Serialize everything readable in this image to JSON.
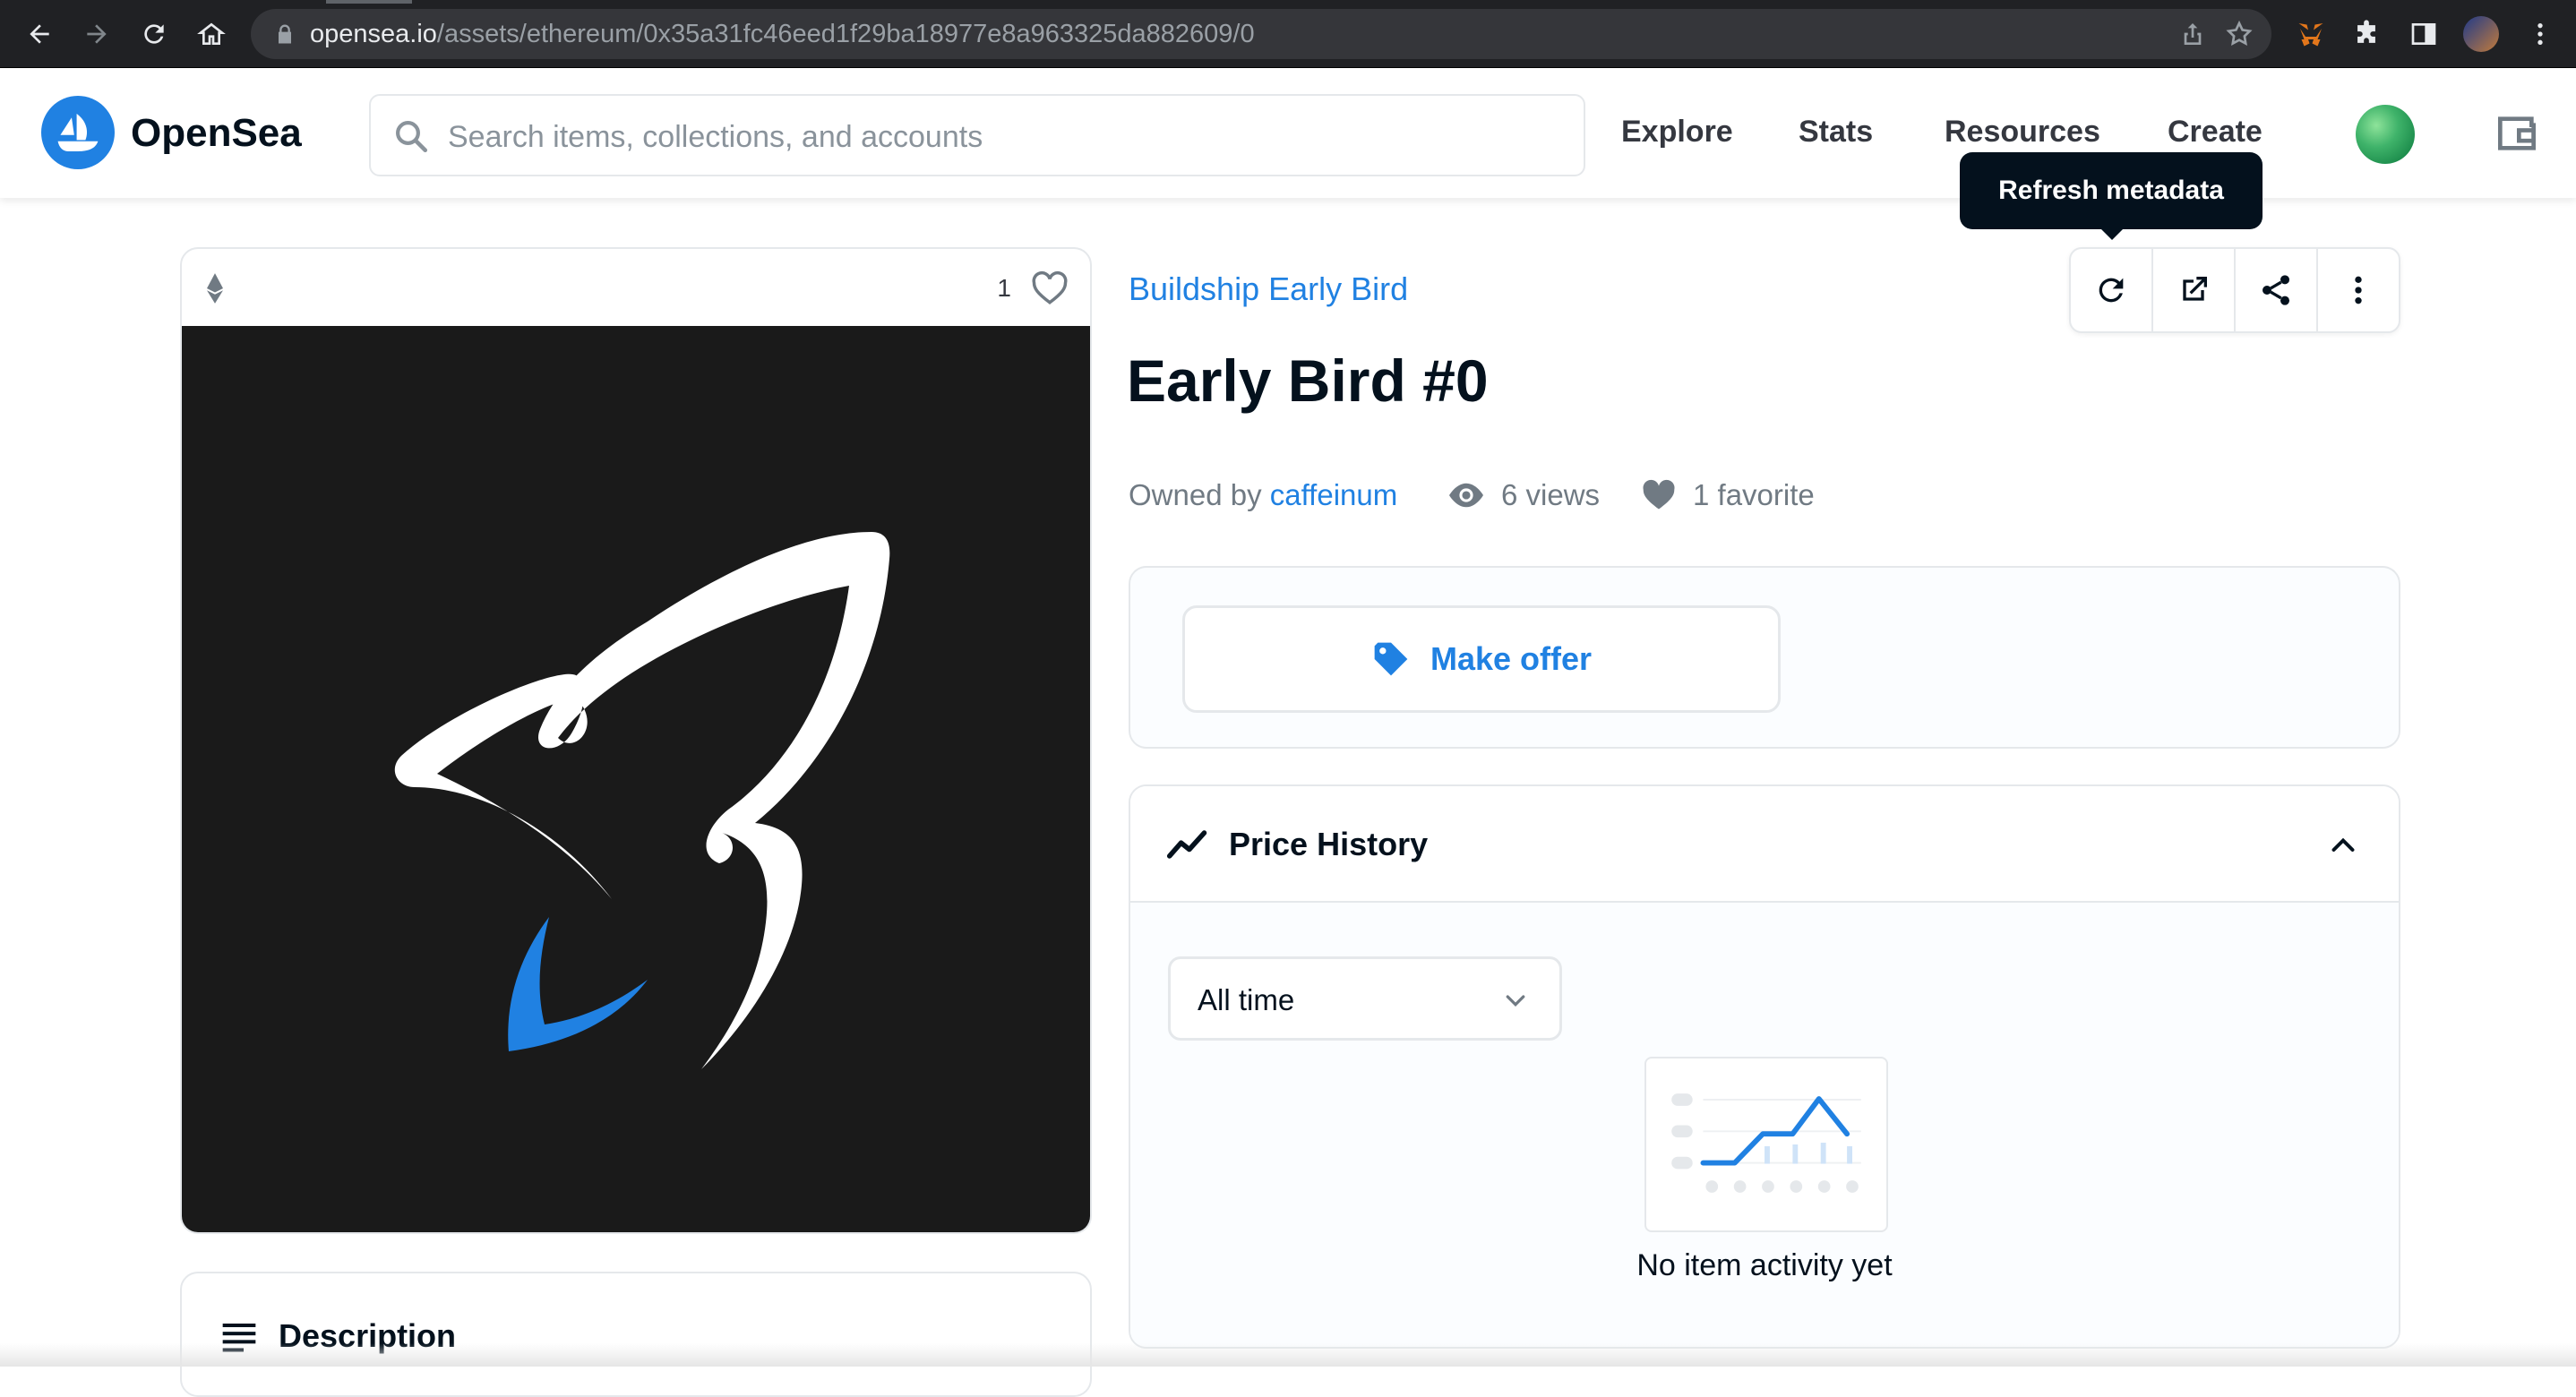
{
  "browser": {
    "url_host": "opensea.io",
    "url_path": "/assets/ethereum/0x35a31fc46eed1f29ba18977e8a963325da882609/0"
  },
  "header": {
    "brand": "OpenSea",
    "search_placeholder": "Search items, collections, and accounts",
    "nav": [
      "Explore",
      "Stats",
      "Resources",
      "Create"
    ]
  },
  "tooltip": "Refresh metadata",
  "item": {
    "collection": "Buildship Early Bird",
    "title": "Early Bird #0",
    "owned_by_label": "Owned by ",
    "owner": "caffeinum",
    "views": "6 views",
    "favorites": "1 favorite",
    "favorite_count": "1"
  },
  "offer": {
    "button_label": "Make offer"
  },
  "price_history": {
    "title": "Price History",
    "period": "All time",
    "empty_text": "No item activity yet"
  },
  "description": {
    "title": "Description"
  },
  "colors": {
    "accent": "#2081e2",
    "text": "#04111d",
    "muted": "#707a83",
    "artwork_bg": "#1a1a1a"
  },
  "icons": {
    "actions": [
      "refresh-icon",
      "external-link-icon",
      "share-icon",
      "more-vertical-icon"
    ]
  }
}
